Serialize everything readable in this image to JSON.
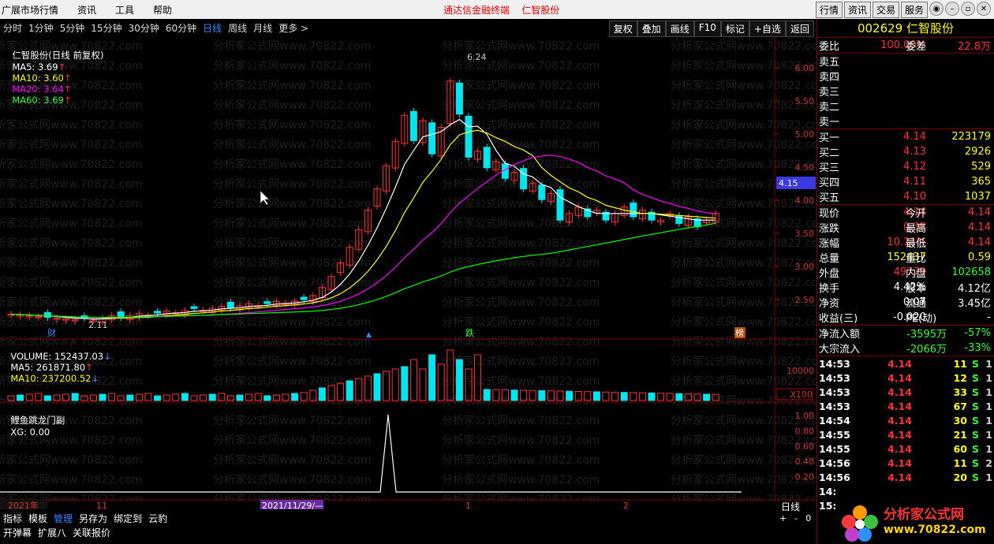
{
  "menubar": {
    "items": [
      "广展市场行情",
      "资讯",
      "工具",
      "帮助"
    ],
    "title": "通达信金融终端    仁智股份",
    "buttons": [
      "行情",
      "资讯",
      "交易",
      "服务"
    ]
  },
  "periods": [
    "分时",
    "1分钟",
    "5分钟",
    "15分钟",
    "30分钟",
    "60分钟",
    "日线",
    "周线",
    "月线",
    "更多 >"
  ],
  "active_period": "日线",
  "toolbar": [
    "复权",
    "叠加",
    "画线",
    "F10",
    "标记",
    "+自选",
    "返回"
  ],
  "main_legend": {
    "name": "仁智股份(日线 前复权)",
    "ma5": "MA5: 3.69",
    "ma10": "MA10: 3.60",
    "ma20": "MA20: 3.64",
    "ma60": "MA60: 3.69"
  },
  "vol_legend": {
    "vol": "VOLUME: 152437.03",
    "ma5": "MA5: 261871.80",
    "ma10": "MA10: 237200.52"
  },
  "ind_legend": {
    "name": "鲤鱼跳龙门副",
    "xg": "XG: 0.00"
  },
  "price_axis": [
    "6.00",
    "5.50",
    "5.00",
    "4.50",
    "4.00",
    "3.50",
    "3.00",
    "2.50"
  ],
  "price_tag": "4.15",
  "high_label": "6.24",
  "low_label": "2.11",
  "vol_axis": [
    "10000",
    "X100"
  ],
  "ind_axis": [
    "1.00",
    "0.80",
    "0.60",
    "0.40",
    "0.20"
  ],
  "markers": {
    "cai": "财",
    "die": "跌",
    "bang": "榜"
  },
  "time_axis": {
    "year": "2021年",
    "m11": "11",
    "cursor": "2021/11/29/—",
    "m1": "1",
    "m2": "2"
  },
  "bottom_tabs": [
    "指标",
    "模板",
    "管理",
    "另存为",
    "绑定到",
    "云豹"
  ],
  "bottom_tabs_selected": "管理",
  "bottom_row2": [
    "开弹幕",
    "扩展八",
    "关联报价"
  ],
  "period_label": "日线",
  "zoom": [
    "+",
    "-",
    "0"
  ],
  "quote": {
    "code": "002629",
    "name": "仁智股份",
    "weibi_label": "委比",
    "weibi": "100.00%",
    "weicha_label": "委差",
    "weicha": "22.8万",
    "asks": [
      "卖五",
      "卖四",
      "卖三",
      "卖二",
      "卖一"
    ],
    "bids": [
      {
        "label": "买一",
        "price": "4.14",
        "vol": "223179"
      },
      {
        "label": "买二",
        "price": "4.13",
        "vol": "2926"
      },
      {
        "label": "买三",
        "price": "4.12",
        "vol": "529"
      },
      {
        "label": "买四",
        "price": "4.11",
        "vol": "365"
      },
      {
        "label": "买五",
        "price": "4.10",
        "vol": "1037"
      }
    ],
    "stats": [
      {
        "l1": "现价",
        "v1": "4.14",
        "l2": "今开",
        "v2": "4.14"
      },
      {
        "l1": "涨跌",
        "v1": "0.38",
        "l2": "最高",
        "v2": "4.14"
      },
      {
        "l1": "涨幅",
        "v1": "10.11%",
        "l2": "最低",
        "v2": "4.14"
      },
      {
        "l1": "总量",
        "v1": "152437",
        "l2": "量比",
        "v2": "0.59"
      },
      {
        "l1": "外盘",
        "v1": "49779",
        "l2": "内盘",
        "v2": "102658"
      },
      {
        "l1": "换手",
        "v1": "4.42%",
        "l2": "股本",
        "v2": "4.12亿"
      },
      {
        "l1": "净资",
        "v1": "0.07",
        "l2": "流通",
        "v2": "3.45亿"
      },
      {
        "l1": "收益(三)",
        "v1": "-0.020",
        "l2": "PE(动)",
        "v2": "-"
      }
    ],
    "flow": [
      {
        "label": "净流入额",
        "v1": "-3595万",
        "v2": "-57%"
      },
      {
        "label": "大宗流入",
        "v1": "-2066万",
        "v2": "-33%"
      }
    ],
    "ticks": [
      {
        "t": "14:53",
        "p": "4.14",
        "v": "11",
        "s": "S",
        "n": "1"
      },
      {
        "t": "14:53",
        "p": "4.14",
        "v": "12",
        "s": "S",
        "n": "1"
      },
      {
        "t": "14:53",
        "p": "4.14",
        "v": "33",
        "s": "S",
        "n": "1"
      },
      {
        "t": "14:53",
        "p": "4.14",
        "v": "67",
        "s": "S",
        "n": "1"
      },
      {
        "t": "14:54",
        "p": "4.14",
        "v": "30",
        "s": "S",
        "n": "1"
      },
      {
        "t": "14:55",
        "p": "4.14",
        "v": "21",
        "s": "S",
        "n": "1"
      },
      {
        "t": "14:55",
        "p": "4.14",
        "v": "60",
        "s": "S",
        "n": "1"
      },
      {
        "t": "14:56",
        "p": "4.14",
        "v": "11",
        "s": "S",
        "n": "2"
      },
      {
        "t": "14:56",
        "p": "4.14",
        "v": "20",
        "s": "S",
        "n": "1"
      }
    ],
    "ticks_tail": [
      "14:",
      "15:"
    ]
  },
  "logo": {
    "text": "分析家公式网",
    "url": "www.70822.com"
  },
  "watermark": "分析家公式网www.70822.com",
  "colors": {
    "up": "#ff3333",
    "down": "#00e5ee",
    "ma5": "#ffffff",
    "ma10": "#ffff00",
    "ma20": "#ff00ff",
    "ma60": "#00ff00"
  }
}
